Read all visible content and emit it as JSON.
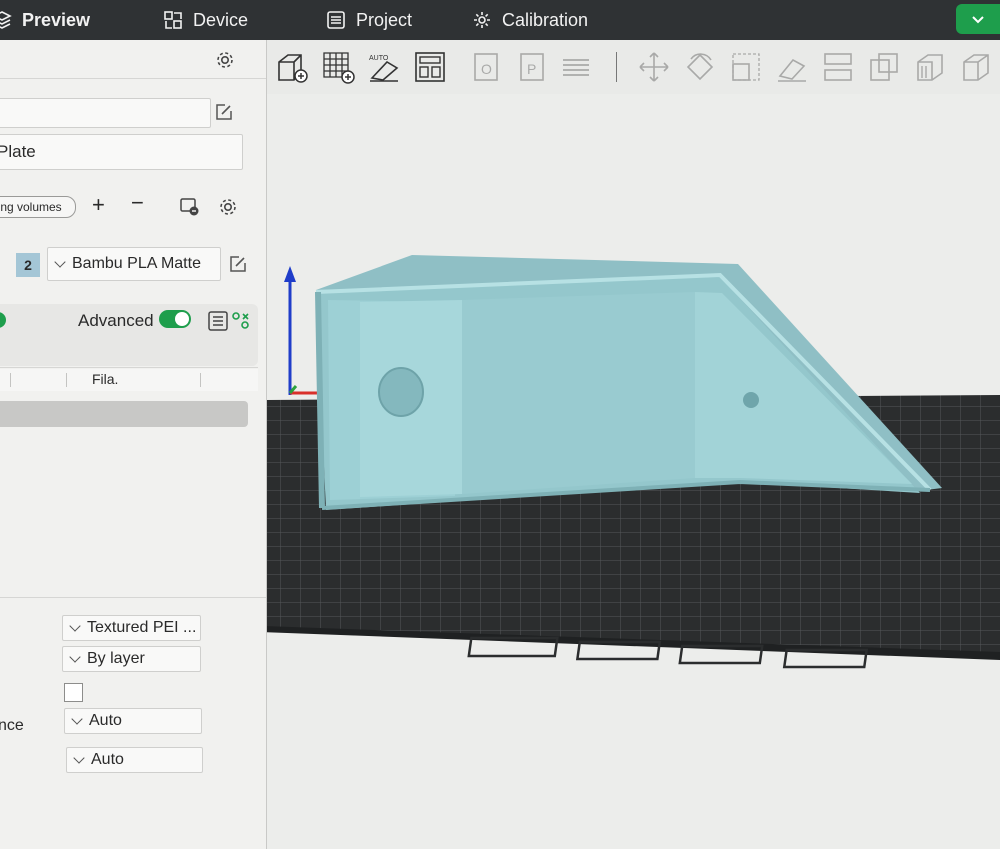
{
  "tabs": [
    {
      "label": "Preview",
      "icon": "layers-icon"
    },
    {
      "label": "Device",
      "icon": "device-icon"
    },
    {
      "label": "Project",
      "icon": "list-icon"
    },
    {
      "label": "Calibration",
      "icon": "calibration-gear-icon"
    }
  ],
  "plate": {
    "name": "Plate"
  },
  "volumes": {
    "button_label": "ng volumes"
  },
  "filament": {
    "index": "2",
    "name": "Bambu PLA Matte"
  },
  "process": {
    "advanced_label": "Advanced",
    "advanced_on": true
  },
  "table": {
    "col_fila": "Fila."
  },
  "settings": {
    "plate_type": "Textured PEI ...",
    "print_sequence": "By layer",
    "row3_label": "nce",
    "dropdown3": "Auto",
    "dropdown4": "Auto"
  },
  "colors": {
    "model": "#94c7cc",
    "accent": "#1e9e4c",
    "topbar": "#2f3234",
    "axis_z": "#1f3dc9"
  }
}
